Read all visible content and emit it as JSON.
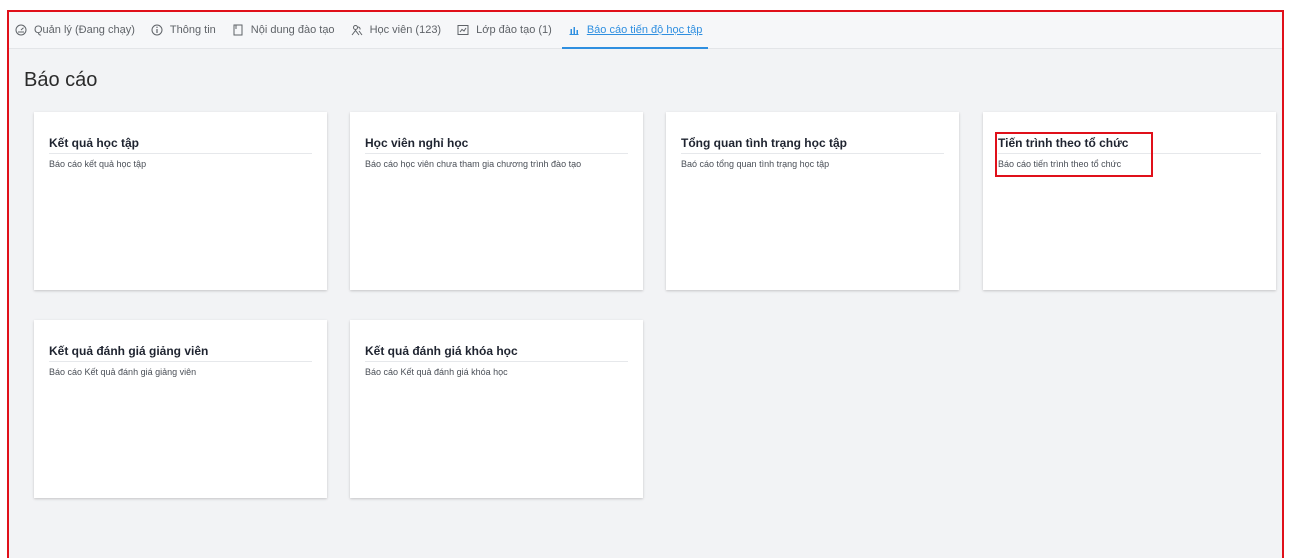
{
  "tabs": [
    {
      "label": "Quản lý (Đang chạy)",
      "icon": "gauge-icon"
    },
    {
      "label": "Thông tin",
      "icon": "info-icon"
    },
    {
      "label": "Nội dung đào tạo",
      "icon": "document-icon"
    },
    {
      "label": "Học viên (123)",
      "icon": "users-icon"
    },
    {
      "label": "Lớp đào tạo (1)",
      "icon": "chart-box-icon"
    },
    {
      "label": "Báo cáo tiến độ học tập",
      "icon": "bar-chart-icon",
      "active": true
    }
  ],
  "page_title": "Báo cáo",
  "cards": [
    {
      "title": "Kết quả học tập",
      "desc": "Báo cáo kết quả học tập"
    },
    {
      "title": "Học viên nghỉ học",
      "desc": "Báo cáo học viên chưa tham gia chương trình đào tạo"
    },
    {
      "title": "Tổng quan tình trạng học tập",
      "desc": "Baó cáo tổng quan tình trạng học tập"
    },
    {
      "title": "Tiến trình theo tổ chức",
      "desc": "Báo cáo tiến trình theo tổ chức",
      "highlighted": true
    },
    {
      "title": "Kết quả đánh giá giảng viên",
      "desc": "Báo cáo Kết quả đánh giá giảng viên"
    },
    {
      "title": "Kết quả đánh giá khóa học",
      "desc": "Báo cáo Kết quả đánh giá khóa học"
    }
  ],
  "colors": {
    "accent": "#2f8fe0",
    "highlight": "#e0101a"
  }
}
